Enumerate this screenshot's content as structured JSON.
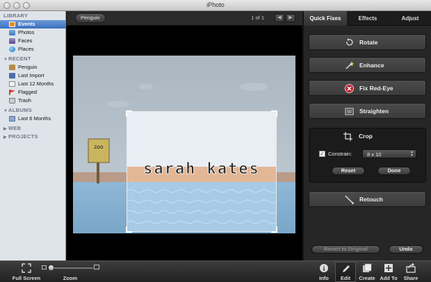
{
  "window": {
    "title": "iPhoto"
  },
  "sidebar": {
    "sections": [
      {
        "label": "LIBRARY",
        "items": [
          {
            "label": "Events",
            "icon": "events-icon",
            "selected": true
          },
          {
            "label": "Photos",
            "icon": "photos-icon"
          },
          {
            "label": "Faces",
            "icon": "faces-icon"
          },
          {
            "label": "Places",
            "icon": "places-icon"
          }
        ]
      },
      {
        "label": "RECENT",
        "items": [
          {
            "label": "Penguin",
            "icon": "event-thumb-icon"
          },
          {
            "label": "Last Import",
            "icon": "import-icon"
          },
          {
            "label": "Last 12 Months",
            "icon": "calendar-icon"
          },
          {
            "label": "Flagged",
            "icon": "flag-icon"
          },
          {
            "label": "Trash",
            "icon": "trash-icon"
          }
        ]
      },
      {
        "label": "ALBUMS",
        "items": [
          {
            "label": "Last 6 Months",
            "icon": "album-icon"
          }
        ]
      },
      {
        "label": "WEB",
        "items": []
      },
      {
        "label": "PROJECTS",
        "items": []
      }
    ]
  },
  "viewer": {
    "event_name": "Penguin",
    "counter": "1 of 1",
    "photo_text": "sarah kates",
    "sign_text": "ZOO"
  },
  "panel": {
    "tabs": [
      "Quick Fixes",
      "Effects",
      "Adjust"
    ],
    "buttons": {
      "rotate": "Rotate",
      "enhance": "Enhance",
      "fix_red_eye": "Fix Red-Eye",
      "straighten": "Straighten",
      "crop": "Crop",
      "retouch": "Retouch"
    },
    "crop": {
      "constrain_label": "Constrain:",
      "constrain_checked": true,
      "ratio": "8 x 10",
      "reset": "Reset",
      "done": "Done"
    },
    "revert": "Revert to Original",
    "undo": "Undo"
  },
  "toolbar": {
    "full_screen": "Full Screen",
    "zoom": "Zoom",
    "zoom_level": 0.05,
    "info": "Info",
    "edit": "Edit",
    "create": "Create",
    "add_to": "Add To",
    "share": "Share"
  },
  "colors": {
    "selection": "#3a6fbf",
    "red_eye": "#c0202a",
    "sky": "#c9d8e6",
    "sand": "#e3b796",
    "water": "#9fc6e3"
  }
}
